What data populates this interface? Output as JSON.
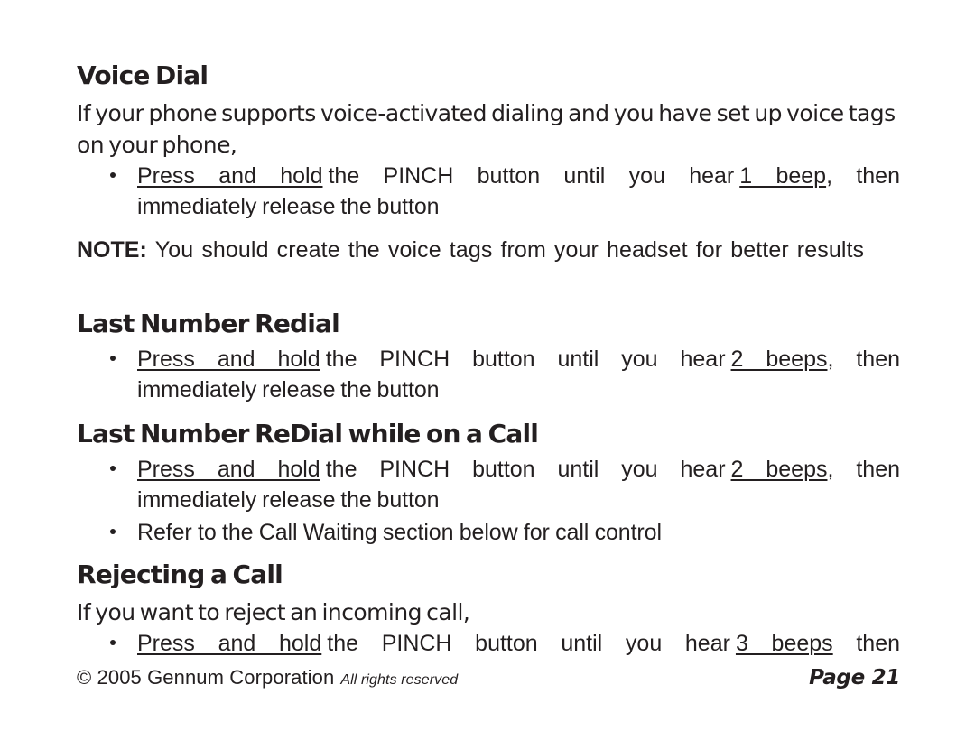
{
  "document": {
    "title": "Gennum Headset User Guide Page",
    "text_color": "#231f20",
    "background_color": "#ffffff"
  },
  "sections": [
    {
      "heading": "Voice Dial",
      "intro": "If your phone supports voice-activated dialing and you have set up voice tags on your phone,",
      "bullets": [
        {
          "line1_parts": {
            "underline1": "Press and hold",
            "mid": "the PINCH button until you hear",
            "underline2": "1 beep",
            "tail": ", then"
          },
          "line2": "immediately release the button"
        }
      ],
      "note": {
        "label": "NOTE:",
        "body": "You should create the voice tags from your headset for better results"
      }
    },
    {
      "heading": "Last Number Redial",
      "bullets": [
        {
          "line1_parts": {
            "underline1": "Press and hold",
            "mid": "the PINCH button until you hear",
            "underline2": "2 beeps",
            "tail": ", then"
          },
          "line2": "immediately release the button"
        }
      ]
    },
    {
      "heading": "Last Number ReDial while on a Call",
      "bullets": [
        {
          "line1_parts": {
            "underline1": "Press and hold",
            "mid": "the PINCH button until you hear",
            "underline2": "2 beeps",
            "tail": ", then"
          },
          "line2": "immediately release the button"
        },
        {
          "single_line": "Refer to the Call Waiting section below for call control"
        }
      ]
    },
    {
      "heading": "Rejecting a Call",
      "intro": "If you want to reject an incoming call,",
      "bullets": [
        {
          "line1_parts": {
            "underline1": "Press and hold",
            "mid": "the PINCH button until you hear",
            "underline2": "3 beeps",
            "tail": " then"
          }
        }
      ]
    }
  ],
  "footer": {
    "copyright": "© 2005 Gennum Corporation",
    "rights": "All rights reserved",
    "page": "Page 21"
  }
}
